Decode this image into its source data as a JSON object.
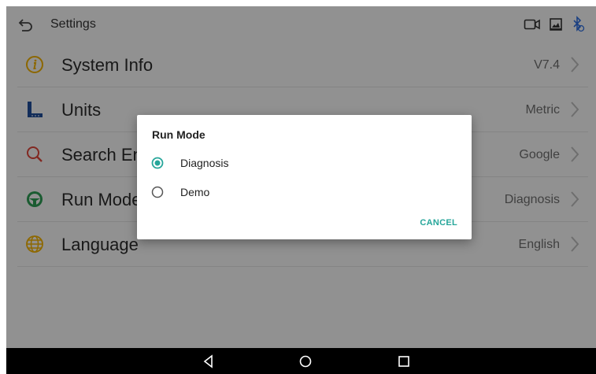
{
  "header": {
    "title": "Settings"
  },
  "settings": [
    {
      "label": "System Info",
      "value": "V7.4",
      "icon": "info-icon"
    },
    {
      "label": "Units",
      "value": "Metric",
      "icon": "ruler-icon"
    },
    {
      "label": "Search Engine",
      "value": "Google",
      "icon": "search-icon"
    },
    {
      "label": "Run Mode",
      "value": "Diagnosis",
      "icon": "steering-wheel-icon"
    },
    {
      "label": "Language",
      "value": "English",
      "icon": "globe-icon"
    }
  ],
  "dialog": {
    "title": "Run Mode",
    "options": [
      {
        "label": "Diagnosis",
        "selected": true
      },
      {
        "label": "Demo",
        "selected": false
      }
    ],
    "cancel_label": "CANCEL"
  },
  "colors": {
    "accent": "#26a69a",
    "info": "#f2b200",
    "ruler": "#1f4e9c",
    "search": "#e0453a",
    "wheel": "#2e9e55",
    "globe": "#f4b400",
    "bluetooth": "#2f6fe0"
  }
}
